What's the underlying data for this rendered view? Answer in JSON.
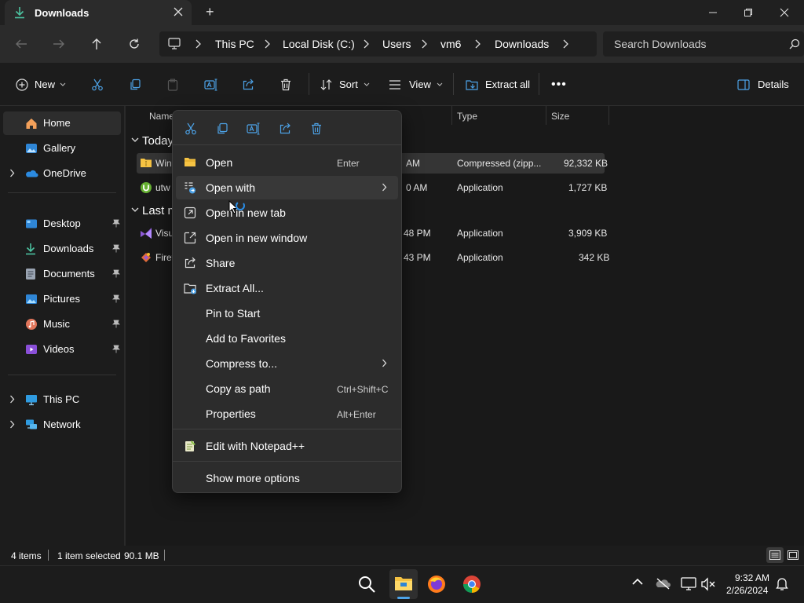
{
  "window": {
    "tab_title": "Downloads",
    "new_tab": "+",
    "minimize": "—",
    "maximize": "▢",
    "close": "✕"
  },
  "address": {
    "breadcrumbs": [
      "This PC",
      "Local Disk (C:)",
      "Users",
      "vm6",
      "Downloads"
    ],
    "search_placeholder": "Search Downloads"
  },
  "toolbar": {
    "new_label": "New",
    "sort_label": "Sort",
    "view_label": "View",
    "extract_all_label": "Extract all",
    "more_label": "•••",
    "details_label": "Details"
  },
  "sidebar": {
    "top": [
      {
        "label": "Home",
        "icon": "home-icon"
      },
      {
        "label": "Gallery",
        "icon": "gallery-icon"
      },
      {
        "label": "OneDrive",
        "icon": "onedrive-icon"
      }
    ],
    "pinned": [
      {
        "label": "Desktop",
        "icon": "desktop-icon"
      },
      {
        "label": "Downloads",
        "icon": "download-icon"
      },
      {
        "label": "Documents",
        "icon": "documents-icon"
      },
      {
        "label": "Pictures",
        "icon": "pictures-icon"
      },
      {
        "label": "Music",
        "icon": "music-icon"
      },
      {
        "label": "Videos",
        "icon": "videos-icon"
      }
    ],
    "bottom": [
      {
        "label": "This PC",
        "icon": "this-pc-icon"
      },
      {
        "label": "Network",
        "icon": "network-icon"
      }
    ]
  },
  "filelist": {
    "columns": [
      "Name",
      "Type",
      "Size"
    ],
    "groups": [
      {
        "label": "Today",
        "rows": [
          {
            "name": "Win",
            "time": "AM",
            "type": "Compressed (zipp...",
            "size": "92,332 KB",
            "selected": true
          },
          {
            "name": "utw",
            "time": "0 AM",
            "type": "Application",
            "size": "1,727 KB",
            "selected": false
          }
        ]
      },
      {
        "label": "Last m",
        "rows": [
          {
            "name": "Visu",
            "time": "48 PM",
            "type": "Application",
            "size": "3,909 KB",
            "selected": false
          },
          {
            "name": "Firef",
            "time": "43 PM",
            "type": "Application",
            "size": "342 KB",
            "selected": false
          }
        ]
      }
    ]
  },
  "context_menu": {
    "items": [
      {
        "label": "Open",
        "shortcut": "Enter",
        "icon": "folder-open-icon"
      },
      {
        "label": "Open with",
        "shortcut": "",
        "icon": "open-with-icon",
        "submenu": true
      },
      {
        "label": "Open in new tab",
        "shortcut": "",
        "icon": "new-tab-icon"
      },
      {
        "label": "Open in new window",
        "shortcut": "",
        "icon": "new-window-icon"
      },
      {
        "label": "Share",
        "shortcut": "",
        "icon": "share-icon"
      },
      {
        "label": "Extract All...",
        "shortcut": "",
        "icon": "extract-icon"
      },
      {
        "label": "Pin to Start",
        "shortcut": "",
        "icon": ""
      },
      {
        "label": "Add to Favorites",
        "shortcut": "",
        "icon": ""
      },
      {
        "label": "Compress to...",
        "shortcut": "",
        "icon": "",
        "submenu": true
      },
      {
        "label": "Copy as path",
        "shortcut": "Ctrl+Shift+C",
        "icon": ""
      },
      {
        "label": "Properties",
        "shortcut": "Alt+Enter",
        "icon": ""
      },
      {
        "label": "Edit with Notepad++",
        "shortcut": "",
        "icon": "notepadpp-icon"
      },
      {
        "label": "Show more options",
        "shortcut": "",
        "icon": ""
      }
    ]
  },
  "status": {
    "item_count": "4 items",
    "selection": "1 item selected",
    "selection_size": "90.1 MB"
  },
  "taskbar": {
    "time": "9:32 AM",
    "date": "2/26/2024"
  },
  "colors": {
    "accent": "#0a84d6",
    "folder_yellow": "#f6c343",
    "selected_row": "#353535"
  }
}
